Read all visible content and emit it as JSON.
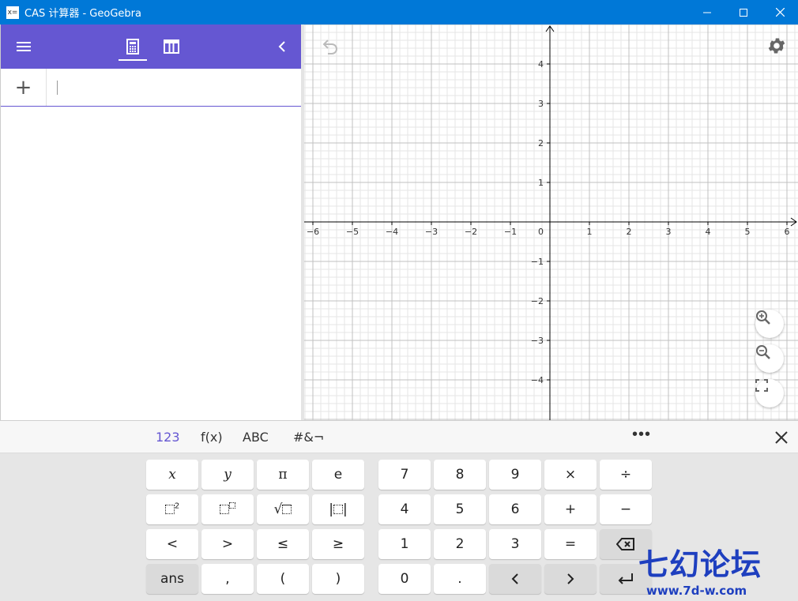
{
  "window": {
    "title": "CAS 计算器 - GeoGebra",
    "icon_text": "x="
  },
  "header": {
    "menu_icon": "hamburger-icon",
    "tabs": [
      {
        "name": "calculator-tab",
        "icon": "calculator-icon",
        "active": true
      },
      {
        "name": "table-tab",
        "icon": "table-icon",
        "active": false
      }
    ],
    "collapse_icon": "chevron-left-icon"
  },
  "algebra": {
    "add_label": "+",
    "input_value": ""
  },
  "graph": {
    "x_ticks": [
      "−6",
      "−5",
      "−4",
      "−3",
      "−2",
      "−1",
      "1",
      "2",
      "3",
      "4",
      "5",
      "6"
    ],
    "y_ticks": [
      "4",
      "3",
      "2",
      "1",
      "−1",
      "−2",
      "−3",
      "−4"
    ],
    "origin_label": "0",
    "axis_color": "#000000",
    "grid_major_color": "#c0c0c0",
    "grid_minor_color": "#e6e6e6"
  },
  "keyboard": {
    "tabs": [
      {
        "label": "123",
        "active": true
      },
      {
        "label": "f(x)",
        "active": false
      },
      {
        "label": "ABC",
        "active": false
      },
      {
        "label": "#&¬",
        "active": false
      }
    ],
    "more_label": "•••",
    "keys_left": {
      "row1": [
        "x",
        "y",
        "π",
        "e"
      ],
      "row3": [
        "<",
        ">",
        "≤",
        "≥"
      ],
      "row4": [
        "ans",
        ",",
        "(",
        ")"
      ]
    },
    "keys_right": {
      "row1": [
        "7",
        "8",
        "9",
        "×",
        "÷"
      ],
      "row2": [
        "4",
        "5",
        "6",
        "+",
        "−"
      ],
      "row3": [
        "1",
        "2",
        "3",
        "="
      ],
      "row4": [
        "0",
        "."
      ]
    }
  },
  "watermark": {
    "brand": "七幻论坛",
    "url": "www.7d-w.com"
  },
  "colors": {
    "titlebar": "#0078d7",
    "accent": "#6557d2"
  }
}
